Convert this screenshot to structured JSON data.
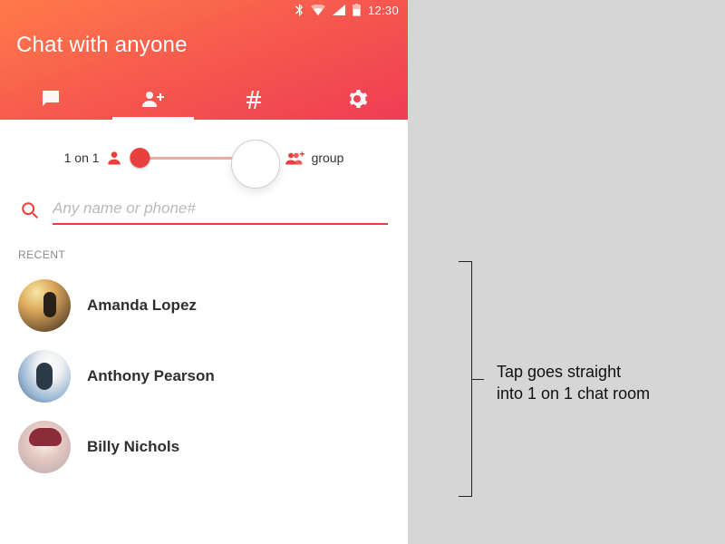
{
  "statusbar": {
    "time": "12:30"
  },
  "header": {
    "title": "Chat with anyone"
  },
  "slider": {
    "left_label": "1 on 1",
    "right_label": "group"
  },
  "search": {
    "placeholder": "Any name or phone#"
  },
  "sections": {
    "recent_label": "RECENT"
  },
  "contacts": [
    {
      "name": "Amanda Lopez"
    },
    {
      "name": "Anthony Pearson"
    },
    {
      "name": "Billy Nichols"
    }
  ],
  "annotation": {
    "line1": "Tap goes straight",
    "line2": "into 1 on 1 chat room"
  }
}
